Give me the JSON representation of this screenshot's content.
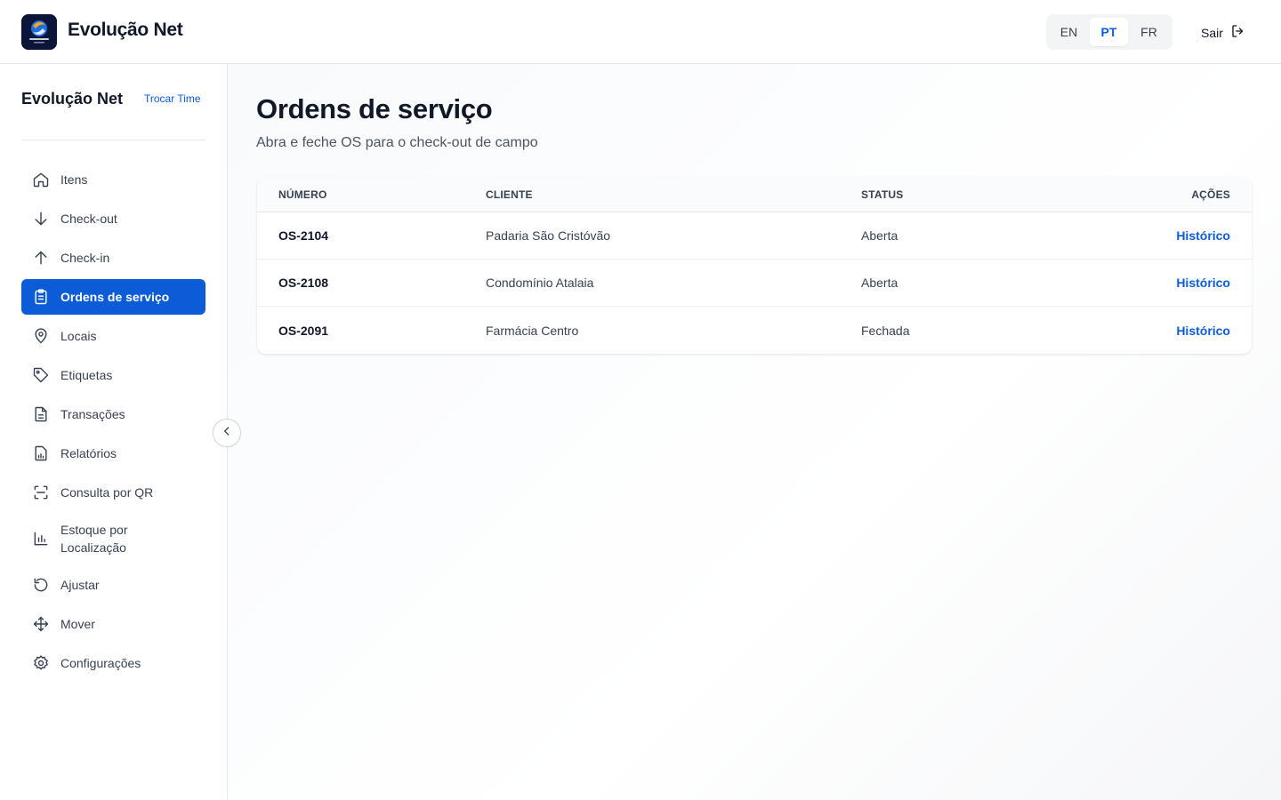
{
  "header": {
    "brand": "Evolução Net",
    "languages": [
      {
        "code": "EN",
        "active": false
      },
      {
        "code": "PT",
        "active": true
      },
      {
        "code": "FR",
        "active": false
      }
    ],
    "logout_label": "Sair",
    "logout_icon": "logout-icon",
    "logo_icon": "brand-logo-icon"
  },
  "sidebar": {
    "team_name": "Evolução Net",
    "switch_team_label": "Trocar Time",
    "items": [
      {
        "label": "Itens",
        "icon": "home-icon",
        "active": false
      },
      {
        "label": "Check-out",
        "icon": "arrow-down-icon",
        "active": false
      },
      {
        "label": "Check-in",
        "icon": "arrow-up-icon",
        "active": false
      },
      {
        "label": "Ordens de serviço",
        "icon": "clipboard-icon",
        "active": true
      },
      {
        "label": "Locais",
        "icon": "map-pin-icon",
        "active": false
      },
      {
        "label": "Etiquetas",
        "icon": "tag-icon",
        "active": false
      },
      {
        "label": "Transações",
        "icon": "document-icon",
        "active": false
      },
      {
        "label": "Relatórios",
        "icon": "report-icon",
        "active": false
      },
      {
        "label": "Consulta por QR",
        "icon": "qr-scan-icon",
        "active": false
      },
      {
        "label": "Estoque por Localização",
        "icon": "bar-chart-icon",
        "active": false
      },
      {
        "label": "Ajustar",
        "icon": "rotate-icon",
        "active": false
      },
      {
        "label": "Mover",
        "icon": "move-icon",
        "active": false
      },
      {
        "label": "Configurações",
        "icon": "gear-icon",
        "active": false
      }
    ],
    "collapse_icon": "chevron-left-icon"
  },
  "main": {
    "title": "Ordens de serviço",
    "subtitle": "Abra e feche OS para o check-out de campo",
    "table": {
      "columns": [
        "NÚMERO",
        "CLIENTE",
        "STATUS",
        "AÇÕES"
      ],
      "rows": [
        {
          "number": "OS-2104",
          "client": "Padaria São Cristóvão",
          "status": "Aberta",
          "action": "Histórico"
        },
        {
          "number": "OS-2108",
          "client": "Condomínio Atalaia",
          "status": "Aberta",
          "action": "Histórico"
        },
        {
          "number": "OS-2091",
          "client": "Farmácia Centro",
          "status": "Fechada",
          "action": "Histórico"
        }
      ]
    }
  },
  "colors": {
    "accent": "#0b5cd6",
    "text": "#111827",
    "muted": "#4b5563",
    "border": "#e5e7eb"
  }
}
